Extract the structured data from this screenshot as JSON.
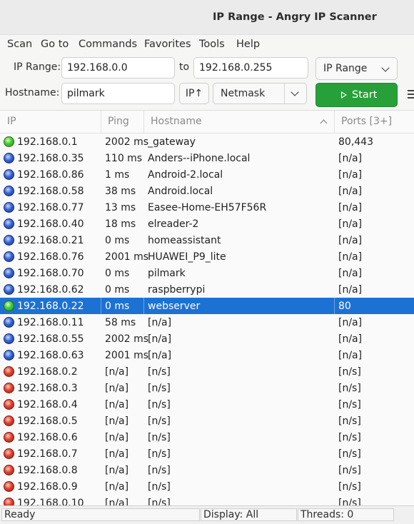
{
  "window": {
    "title": "IP Range - Angry IP Scanner"
  },
  "menu": [
    "Scan",
    "Go to",
    "Commands",
    "Favorites",
    "Tools",
    "Help"
  ],
  "toolbar": {
    "ip_range_label": "IP Range:",
    "range_start": "192.168.0.0",
    "to_label": "to",
    "range_end": "192.168.0.255",
    "feeder_select": "IP Range",
    "hostname_label": "Hostname:",
    "hostname": "pilmark",
    "ip_button": "IP↑",
    "netmask_select": "Netmask",
    "start_label": "Start"
  },
  "table": {
    "headers": {
      "ip": "IP",
      "ping": "Ping",
      "hostname": "Hostname",
      "ports": "Ports [3+]"
    },
    "rows": [
      {
        "status": "green",
        "ip": "192.168.0.1",
        "ping": "2002 ms",
        "hostname": "_gateway",
        "ports": "80,443"
      },
      {
        "status": "blue",
        "ip": "192.168.0.35",
        "ping": "110 ms",
        "hostname": "Anders--iPhone.local",
        "ports": "[n/a]"
      },
      {
        "status": "blue",
        "ip": "192.168.0.86",
        "ping": "1 ms",
        "hostname": "Android-2.local",
        "ports": "[n/a]"
      },
      {
        "status": "blue",
        "ip": "192.168.0.58",
        "ping": "38 ms",
        "hostname": "Android.local",
        "ports": "[n/a]"
      },
      {
        "status": "blue",
        "ip": "192.168.0.77",
        "ping": "13 ms",
        "hostname": "Easee-Home-EH57F56R",
        "ports": "[n/a]"
      },
      {
        "status": "blue",
        "ip": "192.168.0.40",
        "ping": "18 ms",
        "hostname": "elreader-2",
        "ports": "[n/a]"
      },
      {
        "status": "blue",
        "ip": "192.168.0.21",
        "ping": "0 ms",
        "hostname": "homeassistant",
        "ports": "[n/a]"
      },
      {
        "status": "blue",
        "ip": "192.168.0.76",
        "ping": "2001 ms",
        "hostname": "HUAWEI_P9_lite",
        "ports": "[n/a]"
      },
      {
        "status": "blue",
        "ip": "192.168.0.70",
        "ping": "0 ms",
        "hostname": "pilmark",
        "ports": "[n/a]"
      },
      {
        "status": "blue",
        "ip": "192.168.0.62",
        "ping": "0 ms",
        "hostname": "raspberrypi",
        "ports": "[n/a]"
      },
      {
        "status": "green",
        "ip": "192.168.0.22",
        "ping": "0 ms",
        "hostname": "webserver",
        "ports": "80",
        "selected": true
      },
      {
        "status": "blue",
        "ip": "192.168.0.11",
        "ping": "58 ms",
        "hostname": "[n/a]",
        "ports": "[n/a]"
      },
      {
        "status": "blue",
        "ip": "192.168.0.55",
        "ping": "2002 ms",
        "hostname": "[n/a]",
        "ports": "[n/a]"
      },
      {
        "status": "blue",
        "ip": "192.168.0.63",
        "ping": "2001 ms",
        "hostname": "[n/a]",
        "ports": "[n/a]"
      },
      {
        "status": "red",
        "ip": "192.168.0.2",
        "ping": "[n/a]",
        "hostname": "[n/s]",
        "ports": "[n/s]"
      },
      {
        "status": "red",
        "ip": "192.168.0.3",
        "ping": "[n/a]",
        "hostname": "[n/s]",
        "ports": "[n/s]"
      },
      {
        "status": "red",
        "ip": "192.168.0.4",
        "ping": "[n/a]",
        "hostname": "[n/s]",
        "ports": "[n/s]"
      },
      {
        "status": "red",
        "ip": "192.168.0.5",
        "ping": "[n/a]",
        "hostname": "[n/s]",
        "ports": "[n/s]"
      },
      {
        "status": "red",
        "ip": "192.168.0.6",
        "ping": "[n/a]",
        "hostname": "[n/s]",
        "ports": "[n/s]"
      },
      {
        "status": "red",
        "ip": "192.168.0.7",
        "ping": "[n/a]",
        "hostname": "[n/s]",
        "ports": "[n/s]"
      },
      {
        "status": "red",
        "ip": "192.168.0.8",
        "ping": "[n/a]",
        "hostname": "[n/s]",
        "ports": "[n/s]"
      },
      {
        "status": "red",
        "ip": "192.168.0.9",
        "ping": "[n/a]",
        "hostname": "[n/s]",
        "ports": "[n/s]"
      },
      {
        "status": "red",
        "ip": "192.168.0.10",
        "ping": "[n/a]",
        "hostname": "[n/s]",
        "ports": "[n/s]"
      }
    ]
  },
  "status": {
    "state": "Ready",
    "display": "Display: All",
    "threads": "Threads: 0"
  },
  "colors": {
    "start_button": "#27a03a",
    "selection": "#1c72d3",
    "alive_green": "#4cd13a",
    "alive_blue": "#3566d6",
    "dead_red": "#e0422e"
  },
  "icons": {
    "settings": "gear-icon",
    "more": "hamburger-menu-icon",
    "start": "play-icon",
    "sort": "sort-ascending-icon"
  }
}
